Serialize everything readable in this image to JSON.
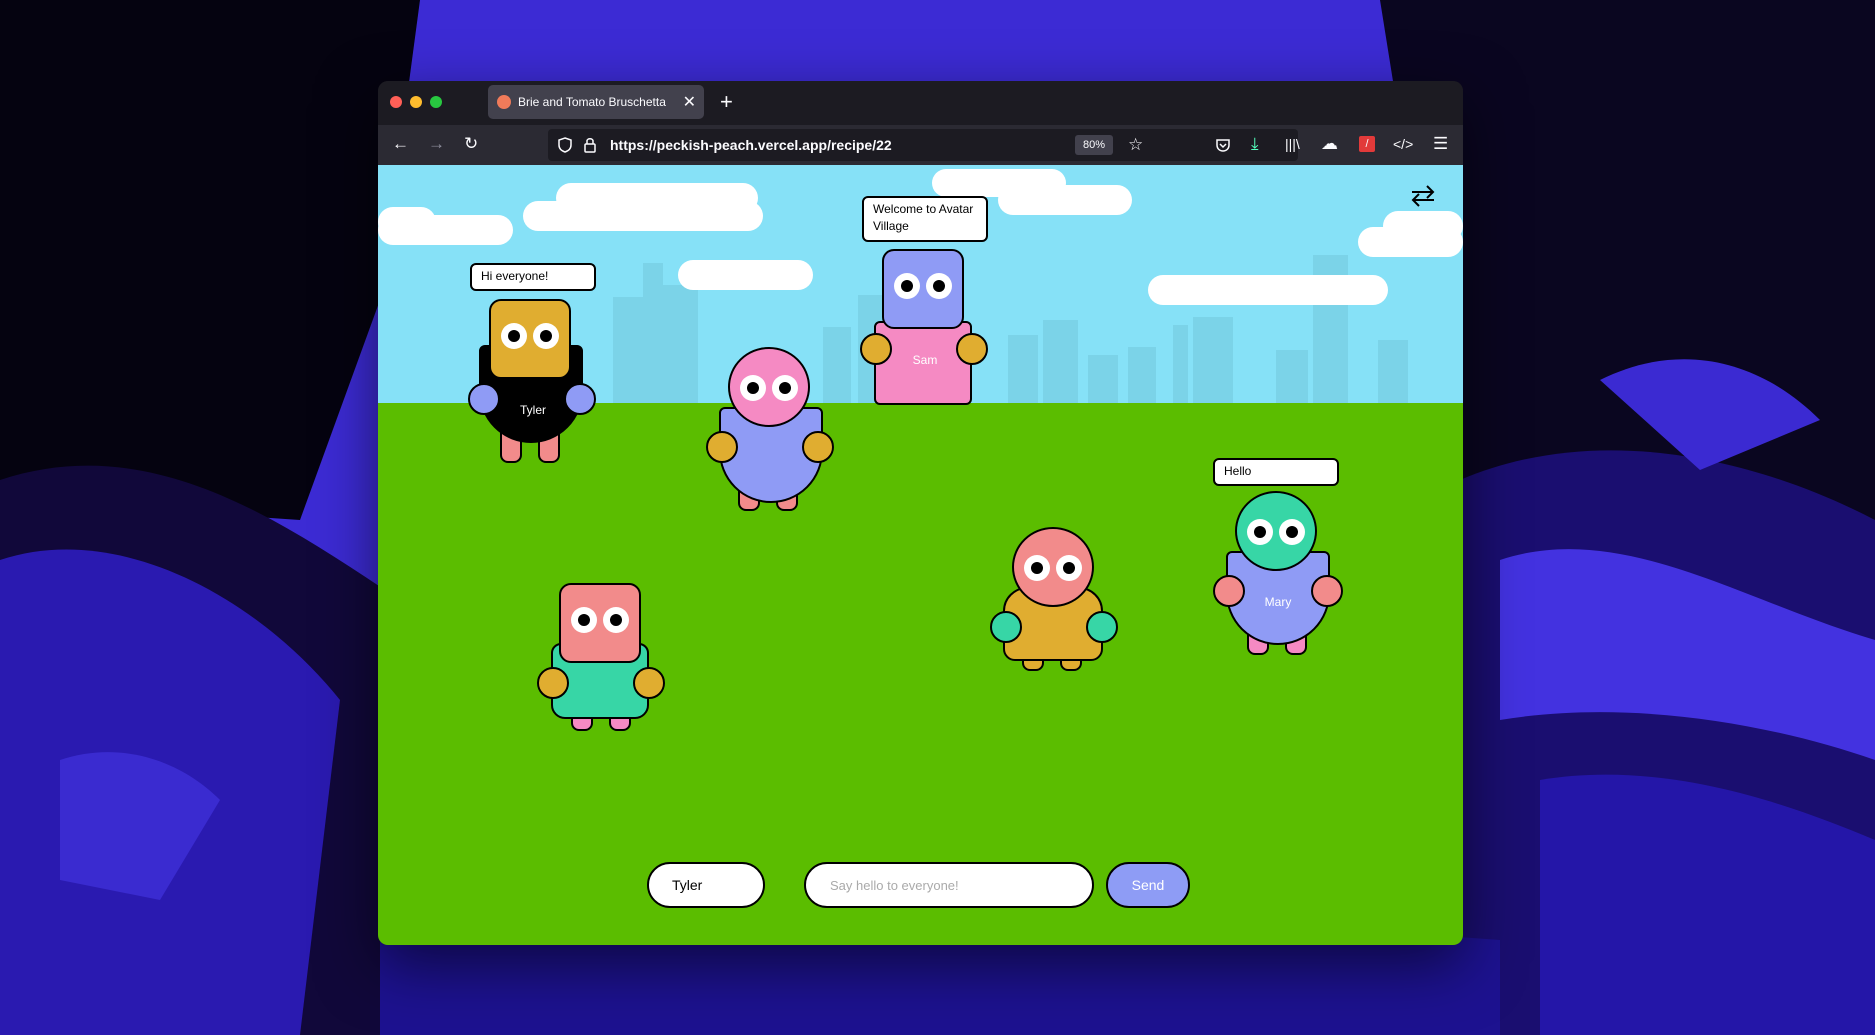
{
  "browser": {
    "tab_title": "Brie and Tomato Bruschetta",
    "url": "https://peckish-peach.vercel.app/recipe/22",
    "zoom": "80%",
    "icons": [
      "back-icon",
      "forward-icon",
      "reload-icon",
      "shield-icon",
      "lock-icon",
      "star-icon",
      "pocket-icon",
      "download-icon",
      "library-icon",
      "extension-icon",
      "devtools-icon",
      "menu-icon"
    ]
  },
  "scene": {
    "avatars": [
      {
        "name": "Tyler",
        "bubble": "Hi everyone!"
      },
      {
        "name": "Sam",
        "bubble": "Welcome to Avatar Village"
      },
      {
        "name": "Mary",
        "bubble": "Hello"
      },
      {
        "name": "",
        "bubble": ""
      },
      {
        "name": "",
        "bubble": ""
      },
      {
        "name": "",
        "bubble": ""
      }
    ]
  },
  "chat": {
    "name_value": "Tyler",
    "message_placeholder": "Say hello to everyone!",
    "send_label": "Send"
  }
}
